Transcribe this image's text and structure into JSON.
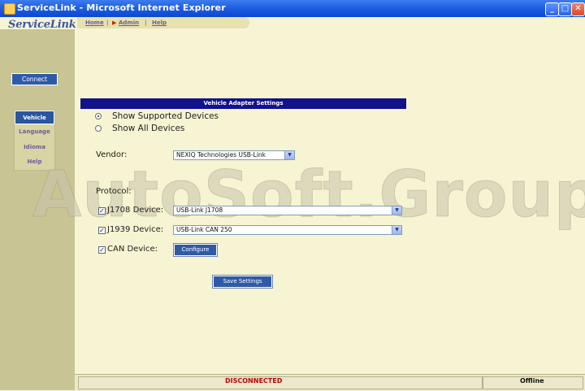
{
  "window": {
    "title": "ServiceLink - Microsoft Internet Explorer",
    "controls": [
      "minimize",
      "maximize",
      "close"
    ]
  },
  "header": {
    "logo": "ServiceLink",
    "nav": [
      {
        "label": "Home"
      },
      {
        "label": "Admin"
      },
      {
        "label": "Help"
      }
    ],
    "admin_marker": "▶"
  },
  "sidebar": {
    "connect_label": "Connect",
    "menu": [
      {
        "label": "Vehicle",
        "active": true
      },
      {
        "label": "Language",
        "active": false
      },
      {
        "label": "Idioma",
        "active": false
      },
      {
        "label": "Help",
        "active": false
      }
    ]
  },
  "panel": {
    "title": "Vehicle Adapter Settings",
    "device_options": [
      {
        "label": "Show Supported Devices",
        "checked": true
      },
      {
        "label": "Show All Devices",
        "checked": false
      }
    ],
    "vendor": {
      "label": "Vendor:",
      "value": "NEXIQ Technologies USB-Link"
    },
    "protocol_label": "Protocol:",
    "devices": [
      {
        "label": "J1708 Device:",
        "checked": true,
        "value": "USB-Link J1708"
      },
      {
        "label": "J1939 Device:",
        "checked": true,
        "value": "USB-Link CAN 250"
      },
      {
        "label": "CAN Device:",
        "checked": true,
        "button": "Configure"
      }
    ],
    "save_label": "Save Settings"
  },
  "watermark": "AutoSoft.Group",
  "status": {
    "connection": "DISCONNECTED",
    "mode": "Offline",
    "connection_color": "#c00000"
  },
  "colors": {
    "accent": "#2f5aa8",
    "panel_title_bg": "#12128a",
    "background": "#f6f4d2",
    "sidebar": "#c8c494"
  }
}
